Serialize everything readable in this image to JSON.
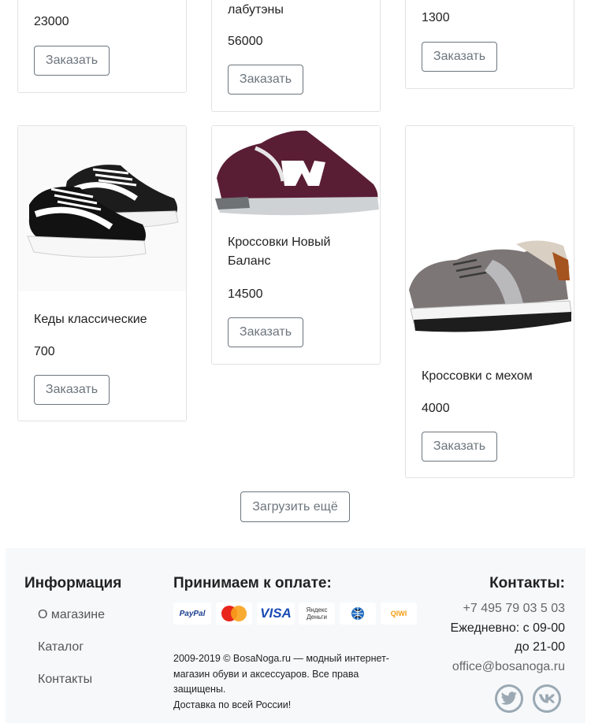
{
  "products_top": [
    {
      "title": "",
      "price": "23000",
      "button": "Заказать"
    },
    {
      "title": "лабутэны",
      "price": "56000",
      "button": "Заказать"
    },
    {
      "title": "",
      "price": "1300",
      "button": "Заказать"
    }
  ],
  "products": [
    {
      "title": "Кеды классические",
      "price": "700",
      "button": "Заказать",
      "image": "black-sneakers"
    },
    {
      "title": "Кроссовки Новый Баланс",
      "price": "14500",
      "button": "Заказать",
      "image": "burgundy-running-shoe"
    },
    {
      "title": "Кроссовки с мехом",
      "price": "4000",
      "button": "Заказать",
      "image": "grey-fur-sneaker"
    }
  ],
  "load_more": "Загрузить ещё",
  "footer": {
    "info_heading": "Информация",
    "links": [
      "О магазине",
      "Каталог",
      "Контакты"
    ],
    "payment_heading": "Принимаем к оплате:",
    "payment_methods": [
      "PayPal",
      "MasterCard",
      "VISA",
      "Яндекс Деньги",
      "WebMoney",
      "QIWI"
    ],
    "legal": "2009-2019 © BosaNoga.ru — модный интернет-магазин обуви и аксессуаров. Все права защищены.",
    "delivery": "Доставка по всей России!",
    "contacts_heading": "Контакты:",
    "phone": "+7 495 79 03 5 03",
    "hours_line1": "Ежедневно: с 09-00",
    "hours_line2": "до 21-00",
    "email": "office@bosanoga.ru",
    "social": [
      "twitter-icon",
      "vk-icon"
    ]
  },
  "colors": {
    "button_border": "#6c757d",
    "footer_bg": "#f7f8fa",
    "social": "#9aa9b3"
  }
}
